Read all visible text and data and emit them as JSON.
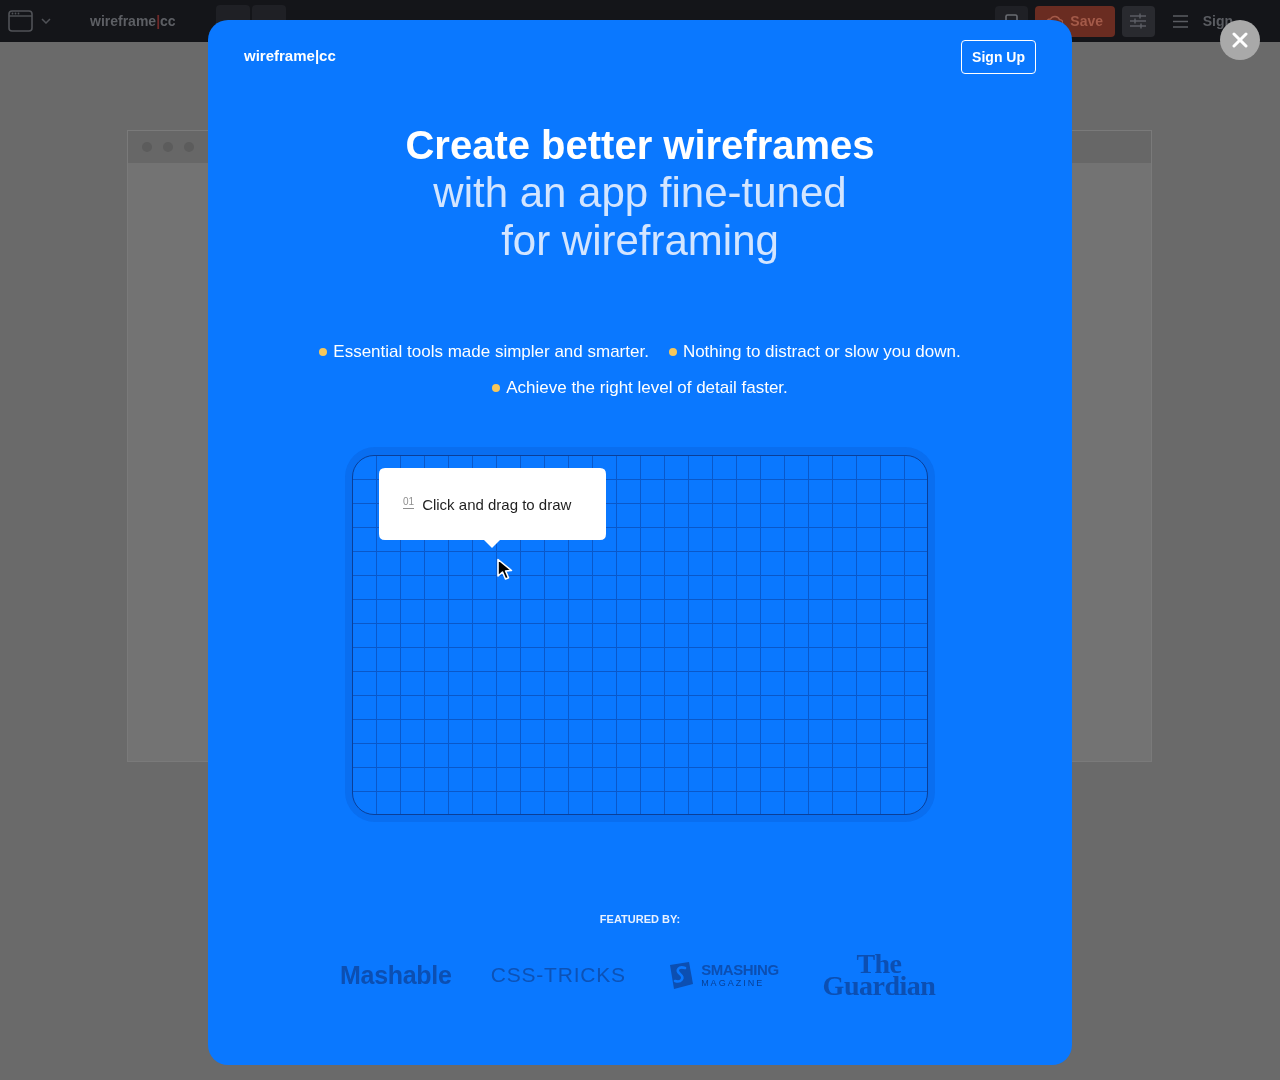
{
  "toolbar": {
    "logo": "wireframe|cc",
    "save_button": "Save",
    "sign_up_link": "Sign"
  },
  "modal": {
    "logo": "wireframe|cc",
    "sign_up_button": "Sign Up",
    "headline": "Create better wireframes",
    "subheadline": "with an app fine-tuned for wireframing",
    "features": [
      "Essential tools made simpler and smarter.",
      "Nothing to distract or slow you down.",
      "Achieve the right level of detail faster."
    ],
    "demo": {
      "tooltip": {
        "step": "01",
        "text": "Click and drag to draw"
      }
    },
    "featured_label": "FEATURED BY:",
    "press_logos": [
      {
        "kind": "heavy",
        "text": "Mashable"
      },
      {
        "kind": "spaced",
        "text": "CSS-TRICKS"
      },
      {
        "kind": "badge",
        "text": "SMASHING",
        "subtitle": "MAGAZINE"
      },
      {
        "kind": "serif",
        "text": "The Guardian"
      }
    ]
  }
}
